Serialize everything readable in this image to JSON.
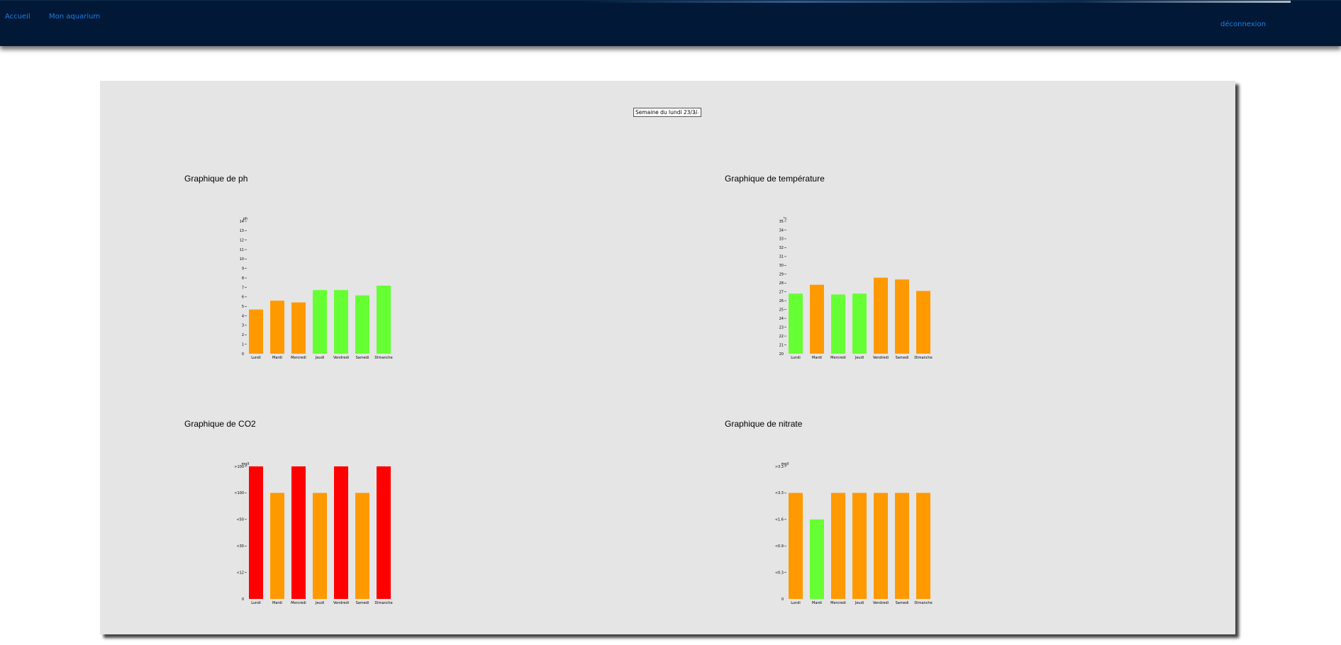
{
  "nav": {
    "home_label": "Accueil",
    "aquarium_label": "Mon aquarium",
    "logout_label": "déconnexion"
  },
  "week_select": {
    "value": "Semaine du lundi 23/3/"
  },
  "colors": {
    "ok": "#66ff33",
    "warning": "#ff9900",
    "danger": "#ff0000",
    "header_bg": "#011836",
    "link": "#1f7fe8"
  },
  "charts": {
    "ph": {
      "title": "Graphique de ph"
    },
    "temperature": {
      "title": "Graphique de température"
    },
    "co2": {
      "title": "Graphique de CO2"
    },
    "nitrate": {
      "title": "Graphique de nitrate"
    }
  },
  "chart_data": [
    {
      "id": "ph",
      "type": "bar",
      "title": "Graphique de ph",
      "ylabel": "ph",
      "categories": [
        "Lundi",
        "Mardi",
        "Mercredi",
        "Jeudi",
        "Vendredi",
        "Samedi",
        "Dimanche"
      ],
      "values": [
        5,
        6,
        5.8,
        7.2,
        7.2,
        6.6,
        7.7
      ],
      "bar_colors": [
        "warning",
        "warning",
        "warning",
        "ok",
        "ok",
        "ok",
        "ok"
      ],
      "ylim": [
        0,
        15
      ],
      "yticks": [
        "0",
        "1",
        "2",
        "3",
        "4",
        "5",
        "6",
        "7",
        "8",
        "9",
        "10",
        "11",
        "12",
        "13",
        "14"
      ]
    },
    {
      "id": "temperature",
      "type": "bar",
      "title": "Graphique de température",
      "ylabel": "°c",
      "categories": [
        "Lundi",
        "Mardi",
        "Mercredi",
        "Jeudi",
        "Vendredi",
        "Samedi",
        "Dimanche"
      ],
      "values": [
        26.8,
        27.8,
        26.7,
        26.8,
        28.6,
        28.4,
        27.1
      ],
      "bar_colors": [
        "ok",
        "warning",
        "ok",
        "ok",
        "warning",
        "warning",
        "warning"
      ],
      "ylim": [
        20,
        35
      ],
      "yticks": [
        "20",
        "21",
        "22",
        "23",
        "24",
        "25",
        "26",
        "27",
        "28",
        "29",
        "30",
        "31",
        "32",
        "33",
        "34",
        "35"
      ]
    },
    {
      "id": "co2",
      "type": "bar",
      "title": "Graphique de CO2",
      "ylabel": "mg/l",
      "categories": [
        "Lundi",
        "Mardi",
        "Mercredi",
        "Jeudi",
        "Vendredi",
        "Samedi",
        "Dimanche"
      ],
      "values": [
        5,
        4,
        5,
        4,
        5,
        4,
        5
      ],
      "bar_colors": [
        "danger",
        "warning",
        "danger",
        "warning",
        "danger",
        "warning",
        "danger"
      ],
      "ylim": [
        0,
        5
      ],
      "yticks": [
        "0",
        "<12",
        "<30",
        "<50",
        "<100",
        ">100"
      ]
    },
    {
      "id": "nitrate",
      "type": "bar",
      "title": "Graphique de nitrate",
      "ylabel": "mg/l",
      "categories": [
        "Lundi",
        "Mardi",
        "Mercredi",
        "Jeudi",
        "Vendredi",
        "Samedi",
        "Dimanche"
      ],
      "values": [
        4,
        3,
        4,
        4,
        4,
        4,
        4
      ],
      "bar_colors": [
        "warning",
        "ok",
        "warning",
        "warning",
        "warning",
        "warning",
        "warning"
      ],
      "ylim": [
        0,
        5
      ],
      "yticks": [
        "0",
        "<0.3",
        "<0.9",
        "<1.6",
        "<3.3",
        ">3.3"
      ]
    }
  ]
}
